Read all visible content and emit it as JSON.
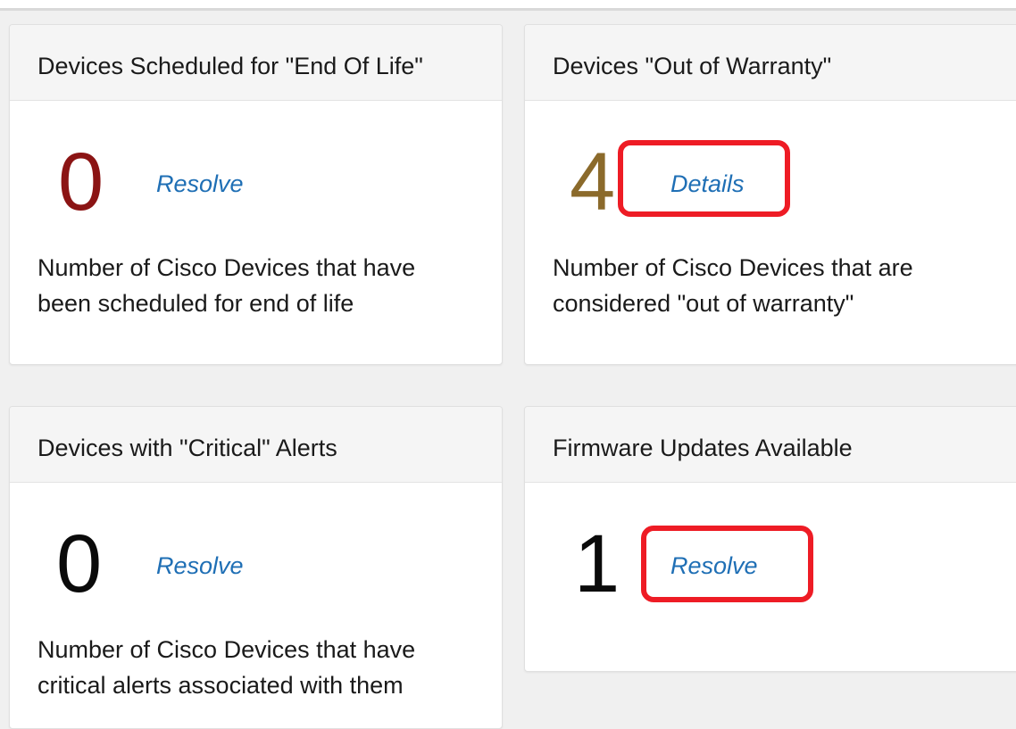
{
  "colors": {
    "eol_number": "#8b1414",
    "warranty_number": "#8b6a2b",
    "default_number": "#0a0a0a",
    "link": "#1f6fb5",
    "highlight": "#ee1c25"
  },
  "cards": [
    {
      "title": "Devices Scheduled for \"End Of Life\"",
      "count": "0",
      "action_label": "Resolve",
      "description": "Number of Cisco Devices that have been scheduled for end of life"
    },
    {
      "title": "Devices \"Out of Warranty\"",
      "count": "4",
      "action_label": "Details",
      "description": "Number of Cisco Devices that are considered \"out of warranty\""
    },
    {
      "title": "Devices with \"Critical\" Alerts",
      "count": "0",
      "action_label": "Resolve",
      "description": "Number of Cisco Devices that have critical alerts associated with them"
    },
    {
      "title": "Firmware Updates Available",
      "count": "1",
      "action_label": "Resolve",
      "description": ""
    }
  ]
}
